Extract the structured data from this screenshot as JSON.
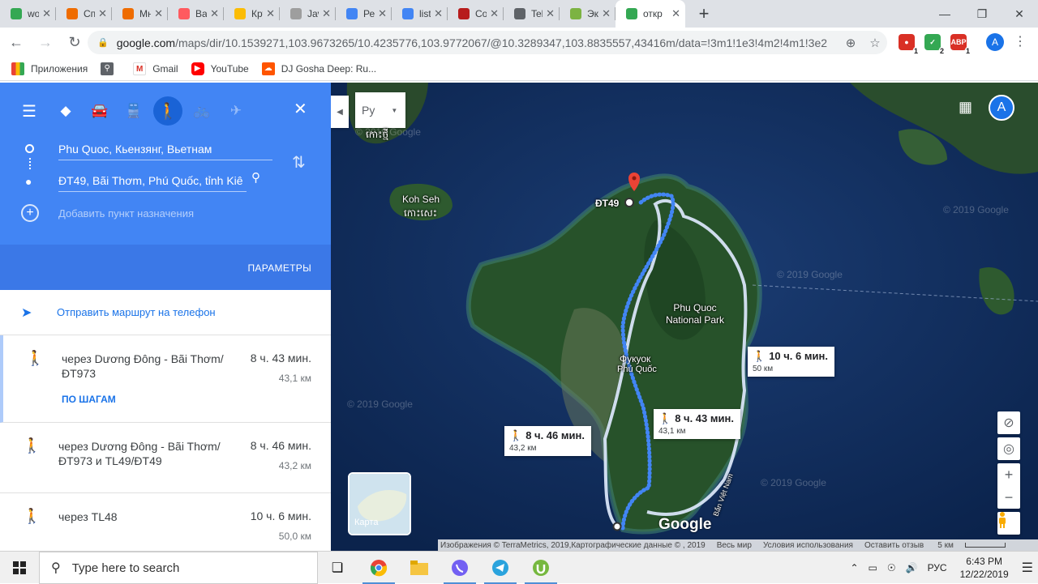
{
  "browser": {
    "tabs": [
      {
        "title": "woo",
        "color": "#34a853"
      },
      {
        "title": "Спис",
        "color": "#ef6c00"
      },
      {
        "title": "Мно",
        "color": "#ef6c00"
      },
      {
        "title": "Bali",
        "color": "#ff5a5f"
      },
      {
        "title": "Круг",
        "color": "#fbbc05"
      },
      {
        "title": "Java",
        "color": "#9e9e9e"
      },
      {
        "title": "Реда",
        "color": "#4285f4"
      },
      {
        "title": "liste",
        "color": "#4285f4"
      },
      {
        "title": "Соб",
        "color": "#b71c1c"
      },
      {
        "title": "Tele",
        "color": "#5f6368"
      },
      {
        "title": "Эко",
        "color": "#7cb342"
      },
      {
        "title": "откр",
        "color": "#34a853",
        "active": true
      }
    ],
    "url_host": "google.com",
    "url_path": "/maps/dir/10.1539271,103.9673265/10.4235776,103.9772067/@10.3289347,103.8835557,43416m/data=!3m1!1e3!4m2!4m1!3e2",
    "extensions": [
      {
        "label": "",
        "badge": "1",
        "color": "#d93025"
      },
      {
        "label": "",
        "badge": "2",
        "color": "#34a853"
      },
      {
        "label": "ABP",
        "badge": "1",
        "color": "#d93025"
      }
    ],
    "profile_initial": "A",
    "bookmarks": [
      {
        "label": "Приложения",
        "icon": "apps-grid-icon"
      },
      {
        "label": "",
        "icon": "search-bookmark-icon"
      },
      {
        "label": "Gmail",
        "icon": "gmail-icon"
      },
      {
        "label": "YouTube",
        "icon": "youtube-icon"
      },
      {
        "label": "DJ Gosha Deep: Ru...",
        "icon": "soundcloud-icon"
      }
    ]
  },
  "directions": {
    "origin": "Phu Quoc, Кьензянг, Вьетнам",
    "destination": "ĐT49, Bãi Thơm, Phú Quốc, tỉnh Kiê",
    "add_destination": "Добавить пункт назначения",
    "options_label": "ПАРАМЕТРЫ",
    "send_to_phone": "Отправить маршрут на телефон",
    "routes": [
      {
        "via": "через Dương Đông - Bãi Thơm/ ĐT973",
        "duration": "8 ч. 43 мин.",
        "distance": "43,1 км",
        "steps_label": "ПО ШАГАМ",
        "selected": true
      },
      {
        "via": "через Dương Đông - Bãi Thơm/ ĐT973 и TL49/ĐT49",
        "duration": "8 ч. 46 мин.",
        "distance": "43,2 км",
        "selected": false
      },
      {
        "via": "через TL48",
        "duration": "10 ч. 6 мин.",
        "distance": "50,0 км",
        "selected": false
      }
    ]
  },
  "map": {
    "search_placeholder": "Ру",
    "profile_initial": "A",
    "labels": {
      "island1_khmer": "កោះថ្មី",
      "koh_seh": "Koh Seh",
      "koh_seh_khmer": "កោះសេះ",
      "destination_marker": "ĐT49",
      "park": "Phu Quoc National Park",
      "town_ru": "Фукуок",
      "town_vn": "Phú Quốc",
      "road": "Bắn Việt Nam"
    },
    "watermarks": [
      "© 2019 Google",
      "© 2019 Google",
      "© 2019 Google",
      "© 2019 Google",
      "© 2019 Google"
    ],
    "route_boxes": [
      {
        "duration": "10 ч. 6 мин.",
        "distance": "50 км"
      },
      {
        "duration": "8 ч. 43 мин.",
        "distance": "43,1 км"
      },
      {
        "duration": "8 ч. 46 мин.",
        "distance": "43,2 км"
      }
    ],
    "minimap_label": "Карта",
    "logo": "Google",
    "footer": {
      "imagery": "Изображения © TerraMetrics, 2019,Картографические данные © , 2019",
      "world": "Весь мир",
      "terms": "Условия использования",
      "feedback": "Оставить отзыв",
      "scale": "5 км"
    }
  },
  "taskbar": {
    "search_placeholder": "Type here to search",
    "language": "РУС",
    "time": "6:43 PM",
    "date": "12/22/2019"
  }
}
